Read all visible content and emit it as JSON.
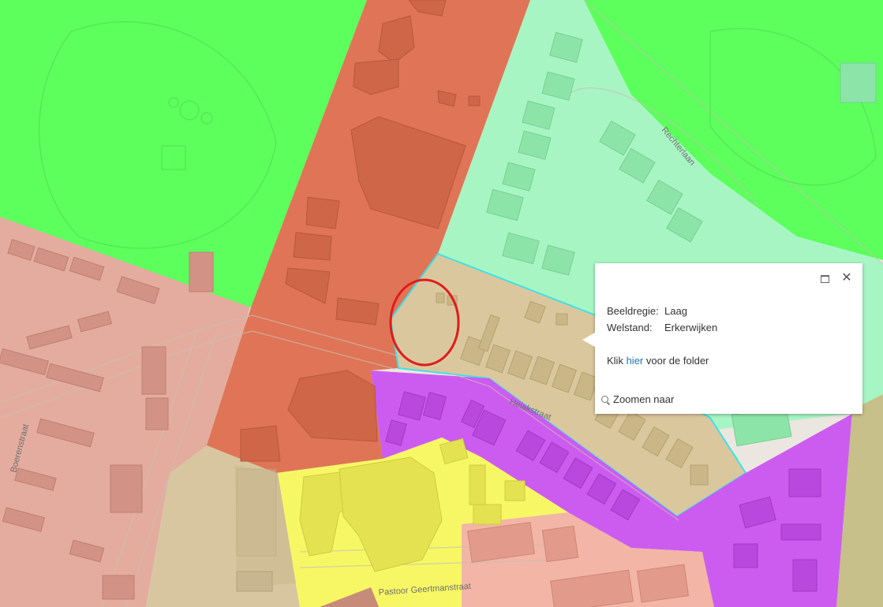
{
  "map": {
    "streets": [
      "Rechterlaan",
      "Heiakstraat",
      "Boerenstraat",
      "Pastoor Geertmanstraat"
    ],
    "colors": {
      "green": "#5cff5c",
      "light_green": "#a8f5c4",
      "red_orange": "#e07556",
      "pink": "#e4ac9f",
      "tan": "#d9c79e",
      "purple": "#cc5cf0",
      "yellow": "#f7f765",
      "salmon": "#f2b5a6",
      "selected_outline": "#3ee0e8",
      "marker_circle": "#e01b1b"
    }
  },
  "popup": {
    "rows": [
      {
        "label": "Beeldregie:",
        "value": "Laag"
      },
      {
        "label": "Welstand:",
        "value": "Erkerwijken"
      }
    ],
    "link_prefix": "Klik",
    "link_text": "hier",
    "link_suffix": "voor de folder",
    "zoom_label": "Zoomen naar",
    "icons": [
      "maximize-icon",
      "close-icon",
      "zoom-icon"
    ]
  }
}
